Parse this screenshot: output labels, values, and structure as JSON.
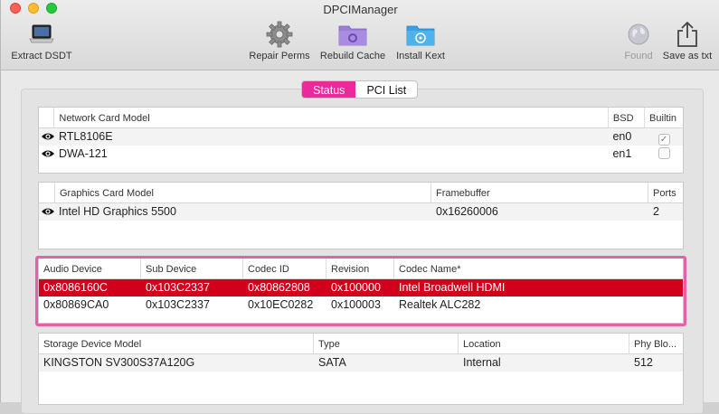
{
  "window": {
    "title": "DPCIManager"
  },
  "toolbar": {
    "extract_dsdt": "Extract DSDT",
    "repair_perms": "Repair Perms",
    "rebuild_cache": "Rebuild Cache",
    "install_kext": "Install Kext",
    "found": "Found",
    "save_as_txt": "Save as txt"
  },
  "tabs": {
    "status": "Status",
    "pci_list": "PCI List"
  },
  "network": {
    "headers": [
      "Network Card Model",
      "BSD",
      "Builtin"
    ],
    "rows": [
      {
        "model": "RTL8106E",
        "bsd": "en0",
        "builtin": true
      },
      {
        "model": "DWA-121",
        "bsd": "en1",
        "builtin": false
      }
    ]
  },
  "graphics": {
    "headers": [
      "Graphics Card Model",
      "Framebuffer",
      "Ports"
    ],
    "rows": [
      {
        "model": "Intel HD Graphics 5500",
        "framebuffer": "0x16260006",
        "ports": "2"
      }
    ]
  },
  "audio": {
    "headers": [
      "Audio Device",
      "Sub Device",
      "Codec ID",
      "Revision",
      "Codec Name*"
    ],
    "rows": [
      [
        "0x8086160C",
        "0x103C2337",
        "0x80862808",
        "0x100000",
        "Intel Broadwell HDMI"
      ],
      [
        "0x80869CA0",
        "0x103C2337",
        "0x10EC0282",
        "0x100003",
        "Realtek ALC282"
      ]
    ]
  },
  "storage": {
    "headers": [
      "Storage Device Model",
      "Type",
      "Location",
      "Phy Blo..."
    ],
    "rows": [
      [
        "KINGSTON SV300S37A120G",
        "SATA",
        "Internal",
        "512"
      ]
    ]
  },
  "colors": {
    "accent": "#ea2a9a",
    "selected_row": "#d1011b",
    "highlight_border": "#e65fa8"
  }
}
